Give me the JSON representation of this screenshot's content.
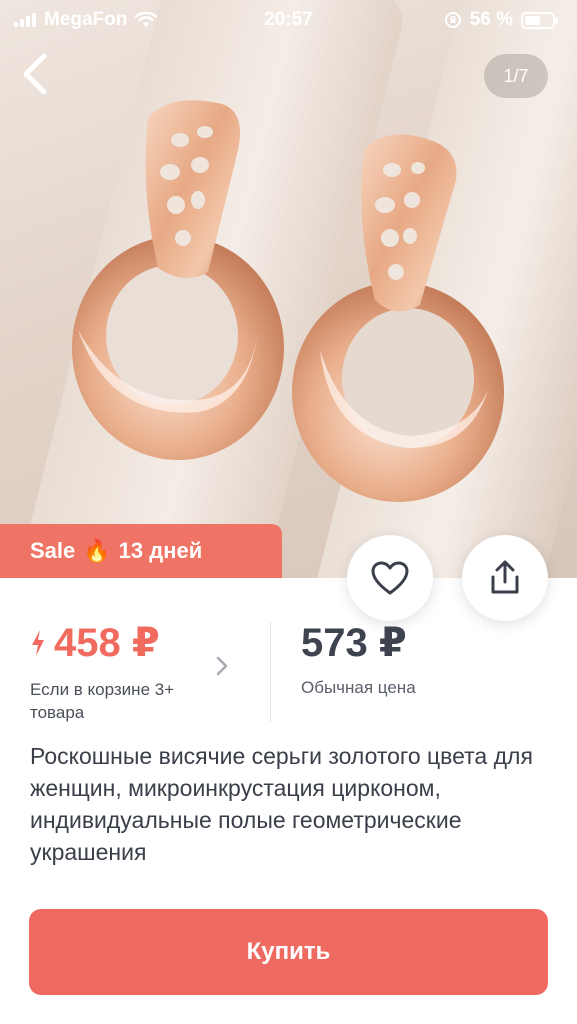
{
  "status_bar": {
    "carrier": "MegaFon",
    "time": "20:57",
    "battery": "56 %"
  },
  "gallery": {
    "counter": "1/7"
  },
  "sale_badge": {
    "label": "Sale",
    "icon": "fire-emoji",
    "days": "13 дней"
  },
  "price": {
    "discount_price": "458 ₽",
    "discount_caption": "Если в корзине 3+ товара",
    "regular_price": "573 ₽",
    "regular_caption": "Обычная цена"
  },
  "product": {
    "title": "Роскошные висячие серьги золотого цвета для женщин, микроинкрустация цирконом, индивидуальные полые геометрические украшения"
  },
  "actions": {
    "buy_label": "Купить"
  },
  "colors": {
    "accent": "#f07466",
    "buy_button": "#ef6b62",
    "price_red": "#f06a5e"
  }
}
